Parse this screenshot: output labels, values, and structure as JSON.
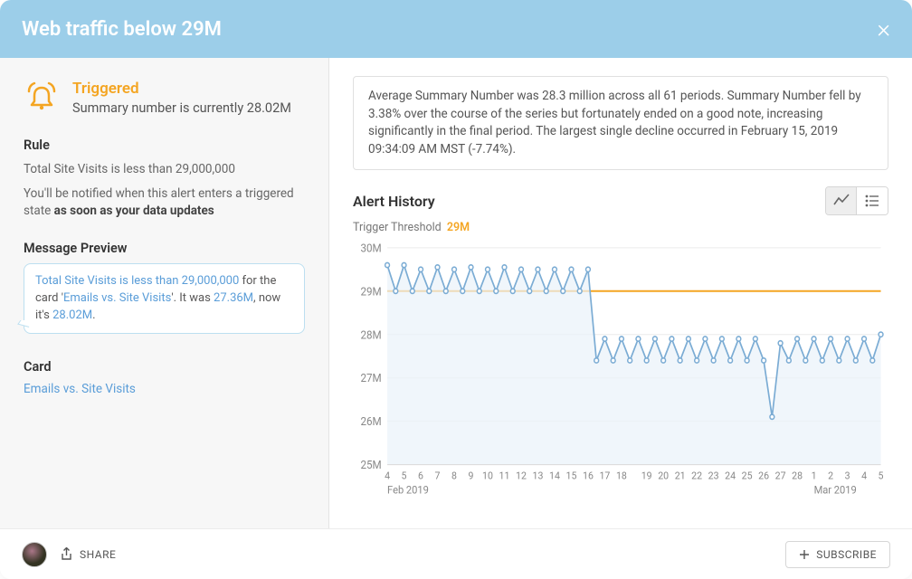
{
  "header": {
    "title": "Web traffic below 29M"
  },
  "status": {
    "label": "Triggered",
    "summary1": "Summary number is currently",
    "summary2": "28.02M"
  },
  "rule": {
    "label": "Rule",
    "text": "Total Site Visits is less than 29,000,000",
    "note_prefix": "You'll be notified when this alert enters a triggered state ",
    "note_strong": "as soon as your data updates"
  },
  "preview": {
    "label": "Message Preview",
    "msg_h1": "Total Site Visits is less than 29,000,000",
    "msg_mid1": " for the card '",
    "msg_h2": "Emails vs. Site Visits",
    "msg_mid2": "'. It was ",
    "msg_h3": "27.36M",
    "msg_mid3": ", now it's ",
    "msg_h4": "28.02M",
    "msg_end": "."
  },
  "card": {
    "label": "Card",
    "link": "Emails vs. Site Visits"
  },
  "summary_box": "Average Summary Number was 28.3 million across all 61 periods. Summary Number fell by 3.38% over the course of the series but fortunately ended on a good note, increasing significantly in the final period. The largest single decline occurred in February 15, 2019 09:34:09 AM MST (-7.74%).",
  "history": {
    "title": "Alert History",
    "threshold_label": "Trigger Threshold",
    "threshold_val": "29M"
  },
  "footer": {
    "share": "SHARE",
    "subscribe": "SUBSCRIBE"
  },
  "chart_data": {
    "type": "line",
    "title": "Alert History",
    "xlabel": "",
    "ylabel": "",
    "ylim": [
      25,
      30
    ],
    "y_ticks": [
      25,
      26,
      27,
      28,
      29,
      30
    ],
    "y_tick_labels": [
      "25M",
      "26M",
      "27M",
      "28M",
      "29M",
      "30M"
    ],
    "threshold": 29,
    "x_tick_labels": [
      "4",
      "5",
      "6",
      "7",
      "8",
      "9",
      "10",
      "11",
      "12",
      "13",
      "14",
      "15",
      "16",
      "17",
      "18",
      "19",
      "20",
      "21",
      "22",
      "23",
      "24",
      "25",
      "26",
      "27",
      "28",
      "1",
      "2",
      "3",
      "4",
      "5"
    ],
    "x_group_labels": [
      {
        "index": 0,
        "label": "Feb 2019"
      },
      {
        "index": 25,
        "label": "Mar 2019"
      }
    ],
    "series": [
      {
        "name": "Summary Number",
        "values": [
          29.6,
          29.0,
          29.6,
          29.0,
          29.5,
          29.0,
          29.55,
          29.0,
          29.5,
          29.0,
          29.55,
          29.0,
          29.5,
          29.0,
          29.55,
          29.0,
          29.5,
          29.0,
          29.5,
          29.0,
          29.5,
          29.0,
          29.5,
          29.0,
          29.5,
          27.4,
          27.9,
          27.4,
          27.9,
          27.4,
          27.9,
          27.4,
          27.9,
          27.4,
          27.9,
          27.4,
          27.9,
          27.4,
          27.9,
          27.4,
          27.9,
          27.4,
          27.9,
          27.4,
          27.9,
          27.4,
          26.1,
          27.8,
          27.4,
          27.9,
          27.4,
          27.9,
          27.4,
          27.9,
          27.4,
          27.9,
          27.4,
          27.9,
          27.4,
          28.0
        ]
      }
    ]
  }
}
